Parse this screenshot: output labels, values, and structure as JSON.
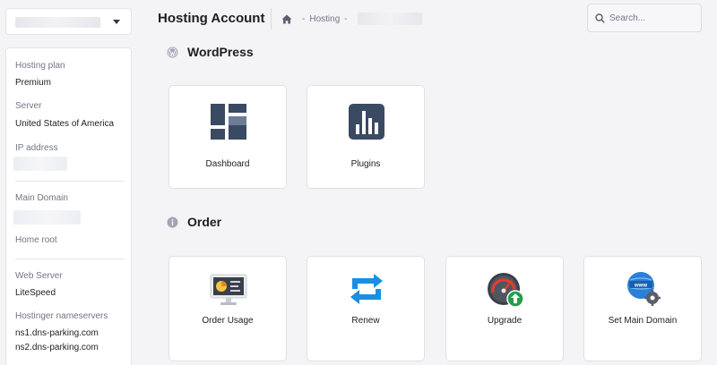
{
  "header": {
    "title": "Hosting Account",
    "breadcrumb": {
      "current": "Hosting"
    }
  },
  "search": {
    "placeholder": "Search..."
  },
  "sidebar": {
    "hosting_plan": {
      "label": "Hosting plan",
      "value": "Premium"
    },
    "server": {
      "label": "Server",
      "value": "United States of America"
    },
    "ip_address": {
      "label": "IP address"
    },
    "main_domain": {
      "label": "Main Domain"
    },
    "home_root": {
      "label": "Home root"
    },
    "web_server": {
      "label": "Web Server",
      "value": "LiteSpeed"
    },
    "nameservers": {
      "label": "Hostinger nameservers",
      "ns1": "ns1.dns-parking.com",
      "ns2": "ns2.dns-parking.com"
    }
  },
  "sections": {
    "wordpress": {
      "title": "WordPress",
      "cards": [
        {
          "label": "Dashboard",
          "icon": "dashboard-icon"
        },
        {
          "label": "Plugins",
          "icon": "plugins-icon"
        }
      ]
    },
    "order": {
      "title": "Order",
      "cards": [
        {
          "label": "Order Usage",
          "icon": "order-usage-icon"
        },
        {
          "label": "Renew",
          "icon": "renew-icon"
        },
        {
          "label": "Upgrade",
          "icon": "upgrade-icon"
        },
        {
          "label": "Set Main Domain",
          "icon": "set-main-domain-icon"
        }
      ]
    }
  },
  "colors": {
    "icon_navy": "#3b4a63",
    "icon_blue": "#1b8fe0",
    "accent_green": "#1ea04a",
    "gauge_red": "#e63c2e",
    "text_dark": "#1d1e20",
    "text_muted": "#727586"
  }
}
